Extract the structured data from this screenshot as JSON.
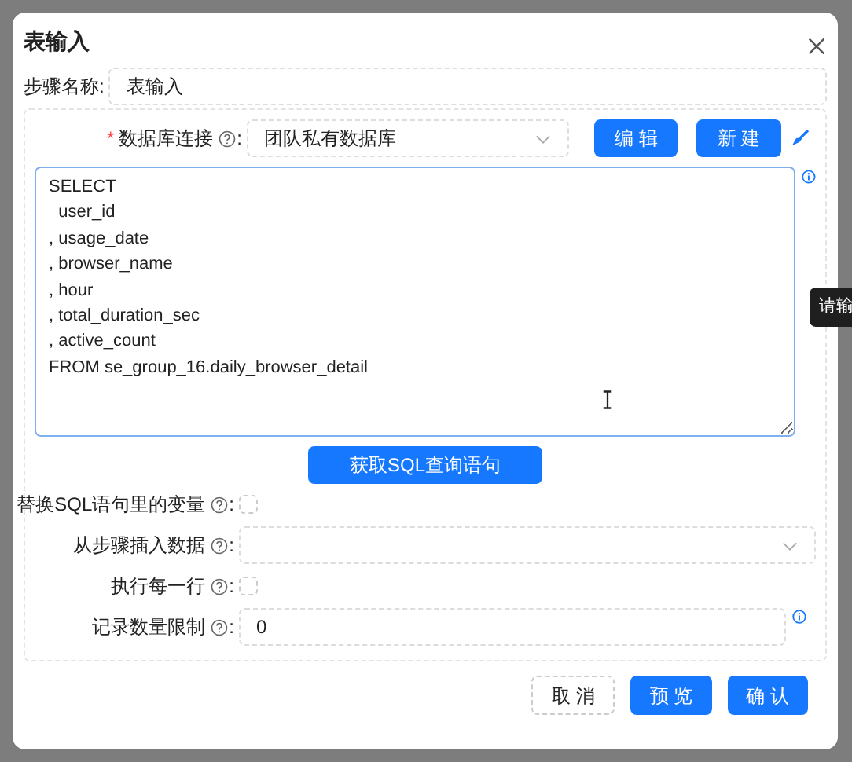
{
  "dialog": {
    "title": "表输入"
  },
  "step_name": {
    "label": "步骤名称:",
    "value": "表输入"
  },
  "connection": {
    "label": "数据库连接",
    "colon": ":",
    "required_mark": "*",
    "value": "团队私有数据库",
    "buttons": [
      "编 辑",
      "新 建"
    ]
  },
  "sql": {
    "lines": [
      "SELECT",
      "  user_id",
      ", usage_date",
      ", browser_name",
      ", hour",
      ", total_duration_sec",
      ", active_count",
      "FROM se_group_16.daily_browser_detail"
    ]
  },
  "tooltip": {
    "text": "请输"
  },
  "get_sql_button": "获取SQL查询语句",
  "options": [
    {
      "kind": "checkbox",
      "label": "替换SQL语句里的变量",
      "colon": ":",
      "checked": false
    },
    {
      "kind": "select",
      "label": "从步骤插入数据",
      "colon": ":"
    },
    {
      "kind": "checkbox",
      "label": "执行每一行",
      "colon": ":",
      "checked": false
    },
    {
      "kind": "input",
      "label": "记录数量限制",
      "colon": ":",
      "value": "0"
    }
  ],
  "footer_buttons": [
    {
      "label": "取 消",
      "kind": "default"
    },
    {
      "label": "预 览",
      "kind": "primary"
    },
    {
      "label": "确 认",
      "kind": "primary"
    }
  ]
}
